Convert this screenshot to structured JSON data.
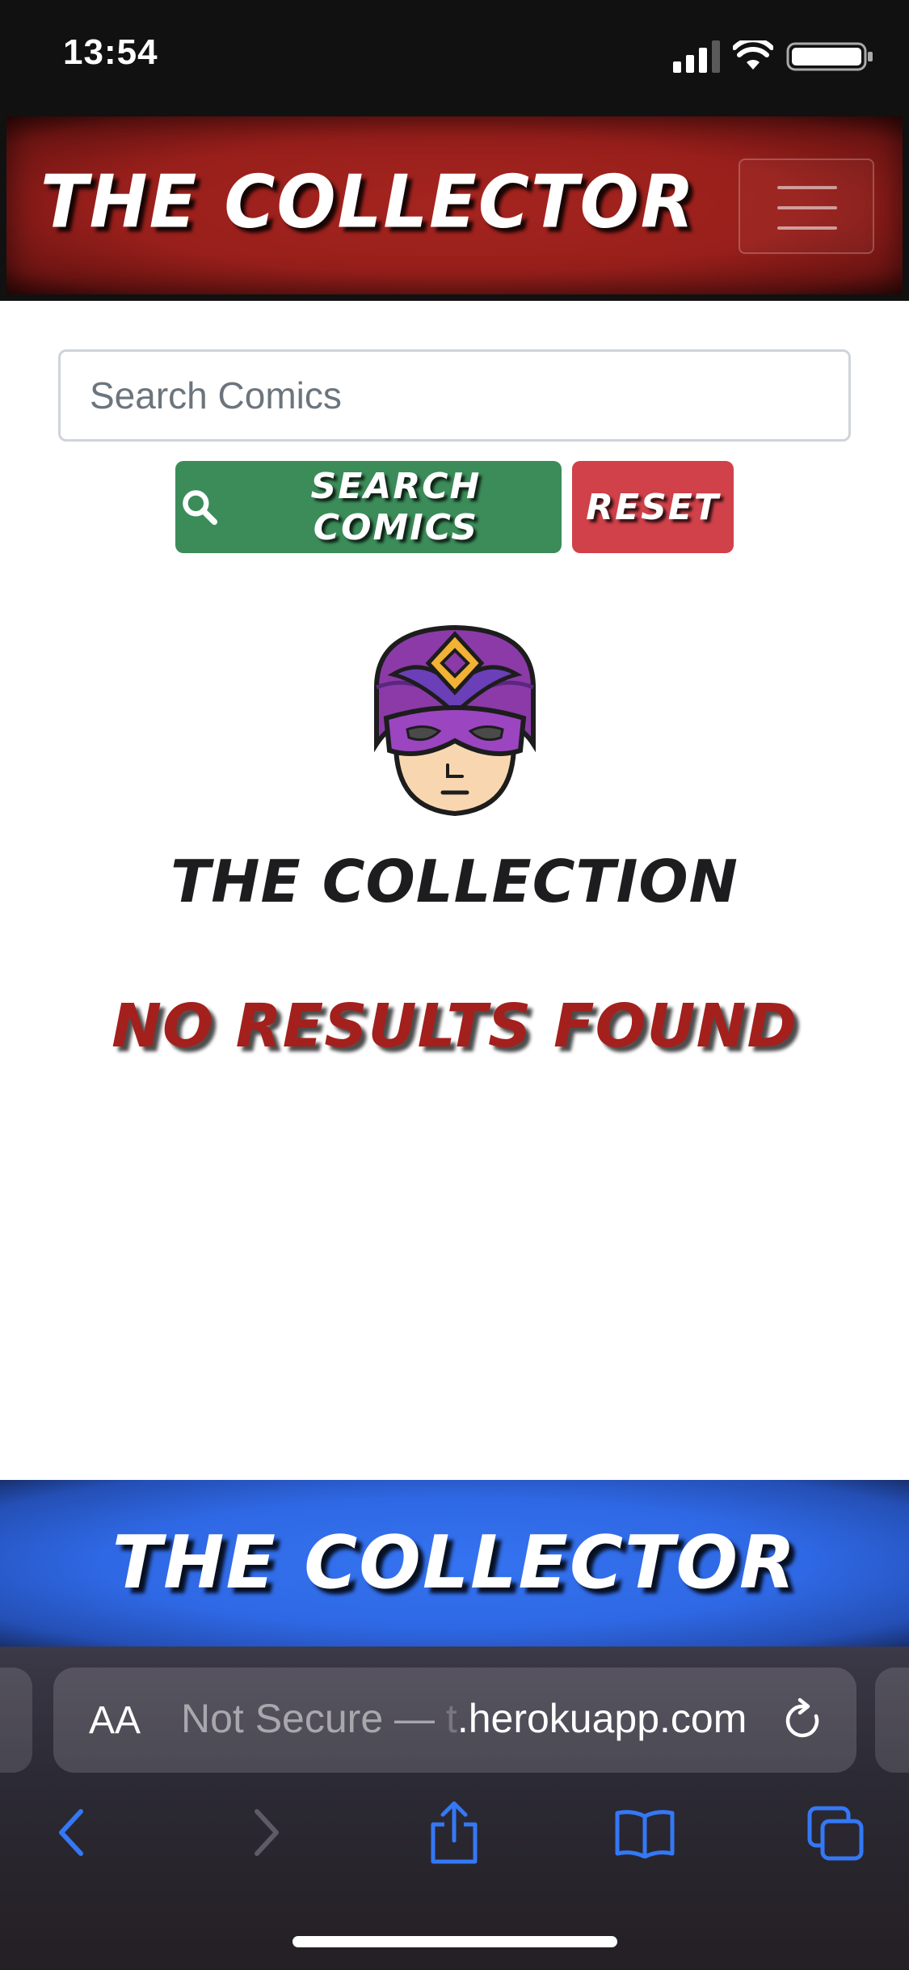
{
  "status_bar": {
    "time": "13:54",
    "icons": [
      "cellular-signal-icon",
      "wifi-icon",
      "battery-icon"
    ]
  },
  "navbar": {
    "brand": "THE COLLECTOR",
    "toggle_icon": "hamburger-menu-icon"
  },
  "search": {
    "placeholder": "Search Comics",
    "value": "",
    "search_button_label": "SEARCH COMICS",
    "reset_button_label": "RESET"
  },
  "main": {
    "hero_icon": "superhero-mask-icon",
    "collection_title": "THE COLLECTION",
    "no_results_text": "NO RESULTS FOUND"
  },
  "footer": {
    "brand": "THE COLLECTOR"
  },
  "browser": {
    "text_size_label": "AA",
    "url_prefix": "Not Secure — ",
    "url_faded": "t",
    "url_domain": ".herokuapp.com",
    "toolbar_icons": [
      "back-icon",
      "forward-icon",
      "share-icon",
      "bookmarks-icon",
      "tabs-icon"
    ]
  },
  "colors": {
    "navbar_red": "#981f1b",
    "search_button_green": "#3b8c59",
    "reset_button_red": "#d0414a",
    "no_results_red": "#a3201d",
    "footer_blue": "#2f68e4",
    "safari_accent_blue": "#3478f6"
  }
}
